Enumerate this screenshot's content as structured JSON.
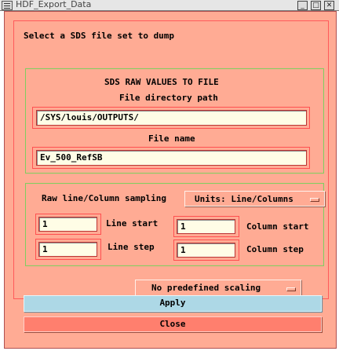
{
  "window": {
    "title": "HDF_Export_Data",
    "minimize_glyph": "_",
    "maximize_glyph": "□",
    "close_glyph": "✕"
  },
  "dialog": {
    "heading": "Select a SDS file set to dump",
    "sds_section": {
      "title": "SDS RAW VALUES TO FILE",
      "dir_label": "File directory path",
      "dir_value": "/SYS/louis/OUTPUTS/",
      "name_label": "File name",
      "name_value": "Ev_500_RefSB"
    },
    "sampling_section": {
      "label": "Raw line/Column sampling",
      "units_value": "Units: Line/Columns",
      "line_start_label": "Line start",
      "line_start_value": "1",
      "line_step_label": "Line step",
      "line_step_value": "1",
      "column_start_label": "Column start",
      "column_start_value": "1",
      "column_step_label": "Column step",
      "column_step_value": "1"
    },
    "scaling_value": "No predefined scaling",
    "apply_label": "Apply",
    "close_label": "Close"
  },
  "colors": {
    "panel_bg": "#ffab94",
    "field_bg": "#fffde6",
    "apply_bg": "#add8e6",
    "close_bg": "#ff7f6e",
    "frame_red": "#ff5a5a",
    "frame_green": "#7fcf5f"
  }
}
